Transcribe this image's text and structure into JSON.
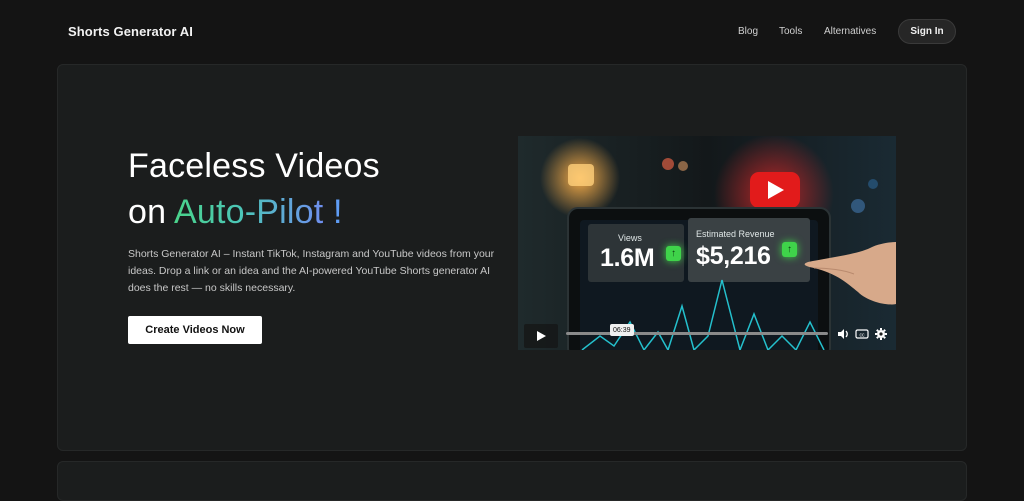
{
  "nav": {
    "brand": "Shorts Generator AI",
    "links": [
      "Blog",
      "Tools",
      "Alternatives"
    ],
    "signin_label": "Sign In"
  },
  "hero": {
    "headline_line1": "Faceless Videos",
    "headline_line2_prefix": "on ",
    "headline_line2_highlight": "Auto-Pilot",
    "headline_line2_suffix": " !",
    "description": "Shorts Generator  AI – Instant TikTok, Instagram and YouTube videos from your ideas. Drop a link  or an idea and the AI-powered YouTube Shorts generator AI does the rest — no skills necessary.",
    "cta_label": "Create Videos Now"
  },
  "video": {
    "views_label": "Views",
    "views_value": "1.6M",
    "revenue_label": "Estimated Revenue",
    "revenue_value": "$5,216",
    "badge_glyph": "↑",
    "timecode": "06:39",
    "icons": [
      "play-icon",
      "volume-icon",
      "captions-icon",
      "gear-icon"
    ],
    "accent_red": "#e21b1b",
    "accent_green": "#3fd34a"
  },
  "colors": {
    "background": "#141414",
    "card": "#1b1d1d",
    "gradient_start": "#4ad38a",
    "gradient_end": "#6f8ff0"
  }
}
